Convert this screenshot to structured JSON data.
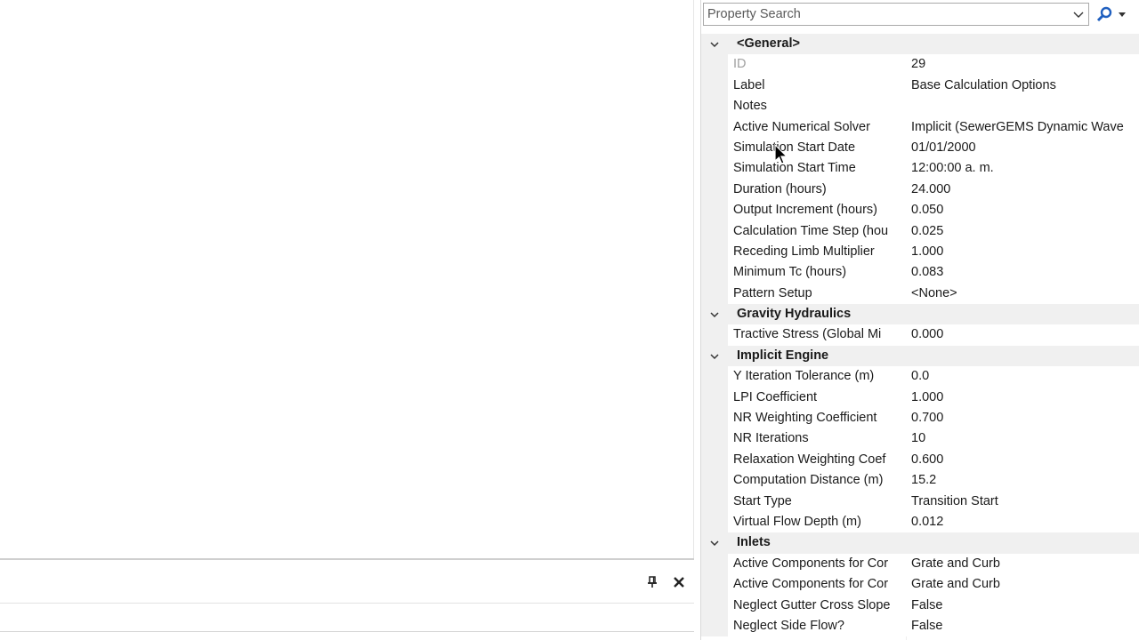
{
  "search": {
    "placeholder": "Property Search"
  },
  "bottom_panel": {
    "pin_icon": "pin-icon",
    "close_icon": "close-icon"
  },
  "categories": [
    {
      "label": "<General>",
      "rows": [
        {
          "name": "ID",
          "value": "29",
          "disabled": true
        },
        {
          "name": "Label",
          "value": "Base Calculation Options"
        },
        {
          "name": "Notes",
          "value": ""
        },
        {
          "name": "Active Numerical Solver",
          "value": "Implicit (SewerGEMS Dynamic Wave"
        },
        {
          "name": "Simulation Start Date",
          "value": "01/01/2000"
        },
        {
          "name": "Simulation Start Time",
          "value": "12:00:00 a. m."
        },
        {
          "name": "Duration (hours)",
          "value": "24.000"
        },
        {
          "name": "Output Increment (hours)",
          "value": "0.050"
        },
        {
          "name": "Calculation Time Step (hou",
          "value": "0.025"
        },
        {
          "name": "Receding Limb Multiplier",
          "value": "1.000"
        },
        {
          "name": "Minimum Tc (hours)",
          "value": "0.083"
        },
        {
          "name": "Pattern Setup",
          "value": "<None>"
        }
      ]
    },
    {
      "label": "Gravity Hydraulics",
      "rows": [
        {
          "name": "Tractive Stress (Global Mi",
          "value": "0.000"
        }
      ]
    },
    {
      "label": "Implicit Engine",
      "rows": [
        {
          "name": "Y Iteration Tolerance (m)",
          "value": "0.0"
        },
        {
          "name": "LPI Coefficient",
          "value": "1.000"
        },
        {
          "name": "NR Weighting Coefficient",
          "value": "0.700"
        },
        {
          "name": "NR Iterations",
          "value": "10"
        },
        {
          "name": "Relaxation Weighting Coef",
          "value": "0.600"
        },
        {
          "name": "Computation Distance (m)",
          "value": "15.2"
        },
        {
          "name": "Start Type",
          "value": "Transition Start"
        },
        {
          "name": "Virtual Flow Depth (m)",
          "value": "0.012"
        }
      ]
    },
    {
      "label": "Inlets",
      "rows": [
        {
          "name": "Active Components for Cor",
          "value": "Grate and Curb"
        },
        {
          "name": "Active Components for Cor",
          "value": "Grate and Curb"
        },
        {
          "name": "Neglect Gutter Cross Slope",
          "value": "False"
        },
        {
          "name": "Neglect Side Flow?",
          "value": "False"
        }
      ]
    }
  ],
  "colors": {
    "accent_icon": "#1f5fbf",
    "category_bg": "#f0f0f0",
    "disabled_text": "#a0a0a0"
  }
}
